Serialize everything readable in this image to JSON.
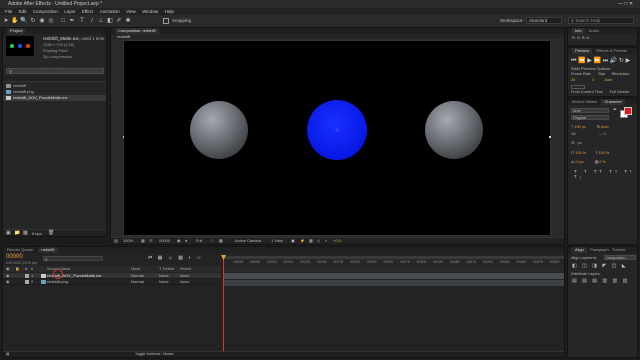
{
  "app": {
    "title": "Adobe After Effects - Untitled Project.aep *",
    "menu": [
      "File",
      "Edit",
      "Composition",
      "Layer",
      "Effect",
      "Animation",
      "View",
      "Window",
      "Help"
    ]
  },
  "toolbar": {
    "snapping": "Snapping",
    "workspace_label": "Workspace:",
    "workspace_value": "Standard",
    "search_placeholder": "Search Help"
  },
  "project": {
    "tab": "Project",
    "selected_name": "redshift_Matte.exr",
    "selected_used": ", used 1 time",
    "info_lines": [
      "1280 x 720 (1.00)",
      "Floating Point",
      "Zip compression",
      "",
      "Linear Light"
    ],
    "items": [
      {
        "name": "redshift",
        "type": "comp"
      },
      {
        "name": "redshift.png",
        "type": "image"
      },
      {
        "name": "redshift_AOV_PuzzleMatte.exr",
        "type": "exr",
        "selected": true
      }
    ],
    "bpc": "8 bpc"
  },
  "composition": {
    "tab": "Composition: redshift",
    "subtab": "redshift",
    "zoom": "100%",
    "timecode": "00000",
    "resolution": "Full",
    "camera": "Active Camera",
    "views": "1 View",
    "exposure": "+0.0"
  },
  "preview": {
    "tab": "Preview",
    "tab2": "Effects & Presets",
    "ram_options": "RAM Preview Options",
    "frame_rate_label": "Frame Rate",
    "skip_label": "Skip",
    "resolution_label": "Resolution",
    "frame_rate": "25",
    "skip": "0",
    "resolution": "Auto",
    "from_current": "From Current Time",
    "full_screen": "Full Screen"
  },
  "info_panel": {
    "tab": "Info",
    "tab2": "Audio",
    "values": [
      "R:",
      "G:",
      "B:",
      "A:"
    ]
  },
  "character": {
    "tab1": "Motion Sketch",
    "tab2": "Character",
    "font": "Arial",
    "style": "Regular",
    "size": "100 px",
    "leading": "Auto",
    "tracking": "0",
    "scale_v": "100 %",
    "scale_h": "100 %",
    "baseline": "0 px",
    "tsume": "0 %",
    "stroke_px": "- px"
  },
  "align": {
    "tab": "Align",
    "tab2": "Paragraph",
    "tab3": "Tracker",
    "align_to_label": "Align Layers to:",
    "align_to_value": "Composition",
    "distribute": "Distribute Layers:"
  },
  "timeline": {
    "tab_render": "Render Queue",
    "tab_comp": "redshift",
    "timecode": "00000",
    "fps": "0:00:00:00 (25.00 fps)",
    "columns": [
      "Source Name",
      "Mode",
      "T TrkMat",
      "Parent"
    ],
    "layers": [
      {
        "num": "1",
        "name": "redshift_AOV_PuzzleMatte.exr",
        "mode": "Normal",
        "trkmat": "None",
        "parent": "None"
      },
      {
        "num": "2",
        "name": "redshift.png",
        "mode": "Normal",
        "trkmat": "None",
        "parent": "None"
      }
    ],
    "ruler": [
      "00025",
      "00050",
      "00075",
      "00100",
      "00125",
      "00150",
      "00175",
      "00200",
      "00225",
      "00250",
      "00275",
      "00300",
      "00325",
      "00350",
      "00375",
      "00400",
      "00425",
      "00450",
      "00475",
      "00500"
    ],
    "toggle": "Toggle Switches / Modes"
  },
  "colors": {
    "blue_sphere": "#0a1ef0",
    "grey_sphere": "#6f747a",
    "accent": "#e8a53a",
    "playhead": "#d23a2a"
  }
}
